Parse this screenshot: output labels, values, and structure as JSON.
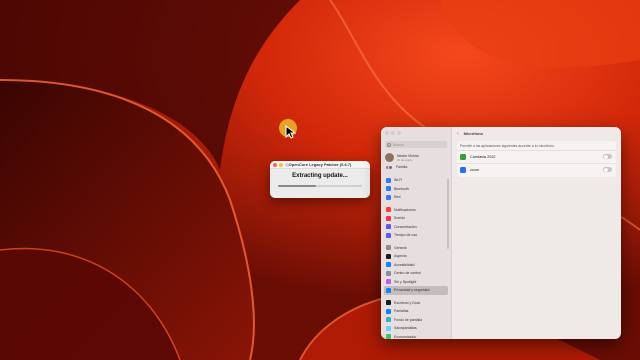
{
  "colors": {
    "accent_toggle_off": "#cdc6c5",
    "wallpaper_red": "#e0300d"
  },
  "progress_window": {
    "title": "OpenCore Legacy Patcher (0.6.7)",
    "status": "Extracting update...",
    "progress_fraction": 0.45
  },
  "settings": {
    "search_placeholder": "Buscar",
    "user": {
      "name": "Nestor Molina",
      "subtitle": "ID de Apple"
    },
    "family": "Familia",
    "groups": [
      [
        {
          "label": "Wi-Fi",
          "icon": "wifi-icon",
          "color": "#3478f6"
        },
        {
          "label": "Bluetooth",
          "icon": "bluetooth-icon",
          "color": "#3478f6"
        },
        {
          "label": "Red",
          "icon": "network-icon",
          "color": "#3478f6"
        }
      ],
      [
        {
          "label": "Notificaciones",
          "icon": "notifications-icon",
          "color": "#ff3b30"
        },
        {
          "label": "Sonido",
          "icon": "sound-icon",
          "color": "#ff2d55"
        },
        {
          "label": "Concentración",
          "icon": "focus-icon",
          "color": "#5e5ce6"
        },
        {
          "label": "Tiempo de uso",
          "icon": "screen-time-icon",
          "color": "#5e5ce6"
        }
      ],
      [
        {
          "label": "General",
          "icon": "general-icon",
          "color": "#8e8e93"
        },
        {
          "label": "Aspecto",
          "icon": "appearance-icon",
          "color": "#1c1c1e"
        },
        {
          "label": "Accesibilidad",
          "icon": "accessibility-icon",
          "color": "#0a84ff"
        },
        {
          "label": "Centro de control",
          "icon": "control-center-icon",
          "color": "#8e8e93"
        },
        {
          "label": "Siri y Spotlight",
          "icon": "siri-icon",
          "color": "#bf5af2"
        },
        {
          "label": "Privacidad y seguridad",
          "icon": "privacy-icon",
          "color": "#0a84ff",
          "selected": true
        }
      ],
      [
        {
          "label": "Escritorio y Dock",
          "icon": "dock-icon",
          "color": "#1c1c1e"
        },
        {
          "label": "Pantallas",
          "icon": "displays-icon",
          "color": "#0a84ff"
        },
        {
          "label": "Fondo de pantalla",
          "icon": "wallpaper-icon",
          "color": "#30b0c7"
        },
        {
          "label": "Salvapantallas",
          "icon": "screensaver-icon",
          "color": "#64d2ff"
        },
        {
          "label": "Economizador",
          "icon": "battery-icon",
          "color": "#34c759"
        }
      ]
    ],
    "main": {
      "title": "Micrófono",
      "description": "Permitir a las aplicaciones siguientes acceder a tu micrófono.",
      "apps": [
        {
          "name": "Camtasia 2022",
          "icon": "camtasia-icon",
          "color": "#3a9d3a",
          "enabled": false
        },
        {
          "name": "zoom",
          "icon": "zoom-icon",
          "color": "#2d6cf0",
          "enabled": false
        }
      ]
    }
  }
}
